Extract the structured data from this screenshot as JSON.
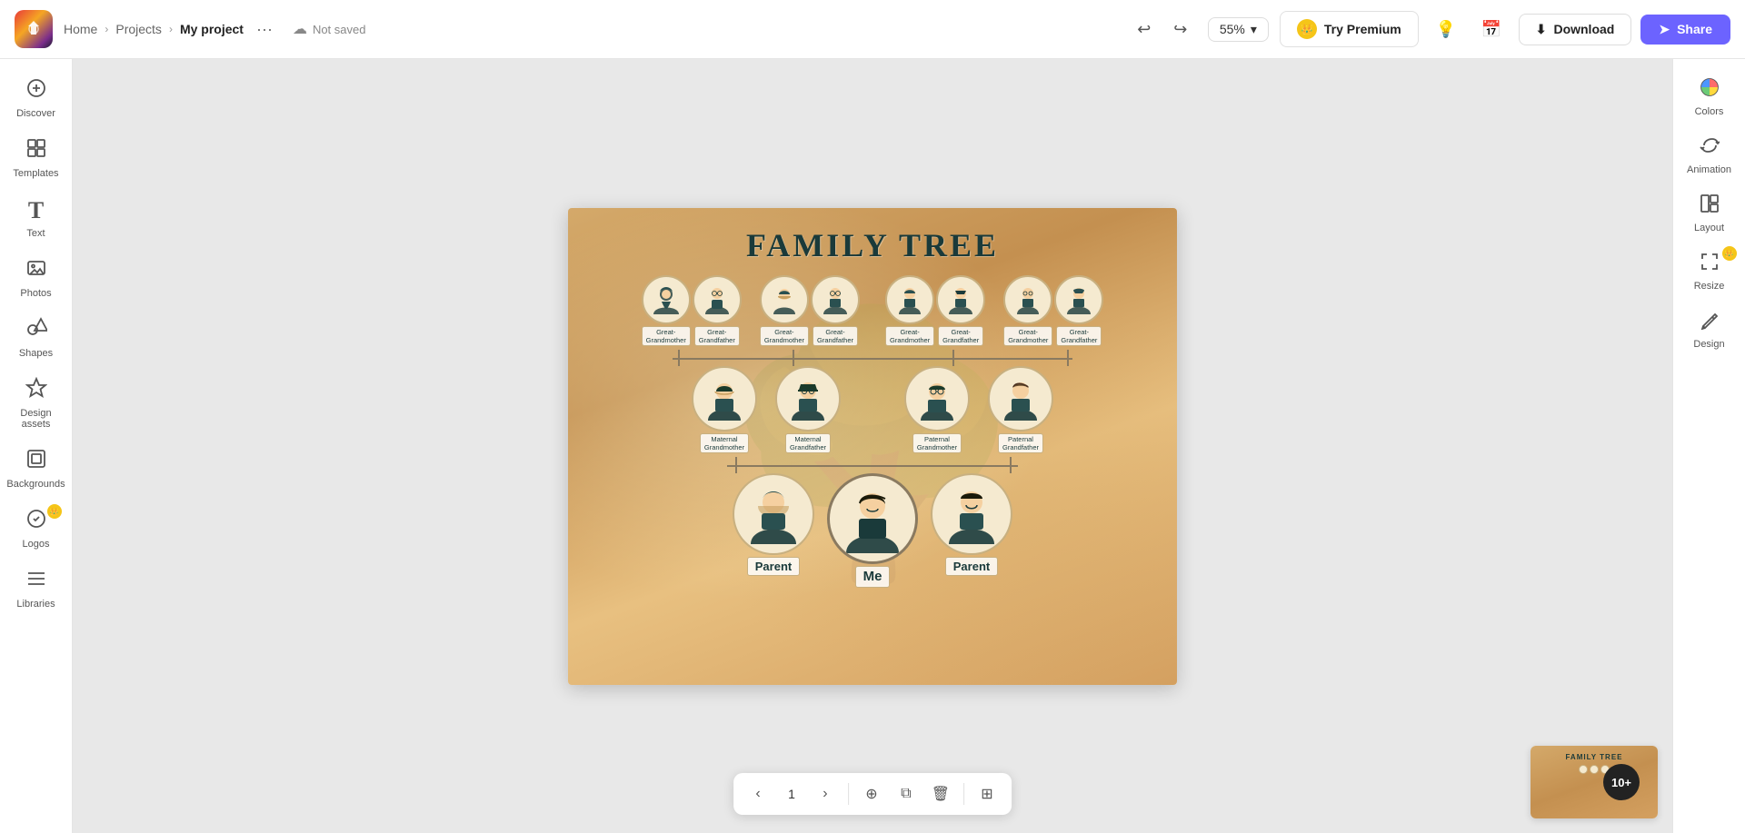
{
  "app": {
    "logo_text": "A",
    "breadcrumb": {
      "home": "Home",
      "projects": "Projects",
      "current": "My project"
    },
    "save_status": "Not saved",
    "zoom": "55%",
    "buttons": {
      "try_premium": "Try Premium",
      "download": "Download",
      "share": "Share"
    }
  },
  "sidebar_left": {
    "items": [
      {
        "id": "discover",
        "icon": "⊞",
        "label": "Discover"
      },
      {
        "id": "templates",
        "icon": "⊡",
        "label": "Templates"
      },
      {
        "id": "text",
        "icon": "T",
        "label": "Text"
      },
      {
        "id": "photos",
        "icon": "🖼",
        "label": "Photos"
      },
      {
        "id": "shapes",
        "icon": "◯",
        "label": "Shapes"
      },
      {
        "id": "design-assets",
        "icon": "✦",
        "label": "Design assets"
      },
      {
        "id": "backgrounds",
        "icon": "▣",
        "label": "Backgrounds"
      },
      {
        "id": "logos",
        "icon": "◈",
        "label": "Logos",
        "badge": "crown"
      },
      {
        "id": "libraries",
        "icon": "⊟",
        "label": "Libraries"
      }
    ]
  },
  "sidebar_right": {
    "items": [
      {
        "id": "colors",
        "icon": "◑",
        "label": "Colors"
      },
      {
        "id": "animation",
        "icon": "◈",
        "label": "Animation"
      },
      {
        "id": "layout",
        "icon": "⊞",
        "label": "Layout"
      },
      {
        "id": "resize",
        "icon": "⤡",
        "label": "Resize",
        "badge": "crown"
      },
      {
        "id": "design",
        "icon": "✏",
        "label": "Design"
      }
    ]
  },
  "canvas": {
    "title": "FAMILY TREE",
    "generation1": [
      {
        "label": "Great-\nGrandmother"
      },
      {
        "label": "Great-\nGrandfather"
      },
      {
        "label": "Great-\nGrandmother"
      },
      {
        "label": "Great-\nGrandfather"
      },
      {
        "label": "Great-\nGrandmother"
      },
      {
        "label": "Great-\nGrandfather"
      },
      {
        "label": "Great-\nGrandmother"
      },
      {
        "label": "Great-\nGrandfather"
      }
    ],
    "generation2": [
      {
        "label": "Maternal\nGrandmother"
      },
      {
        "label": "Maternal\nGrandfather"
      },
      {
        "label": "Paternal\nGrandmother"
      },
      {
        "label": "Paternal\nGrandfather"
      }
    ],
    "generation3": [
      {
        "label": "Parent"
      },
      {
        "label": "Me"
      },
      {
        "label": "Parent"
      }
    ]
  },
  "page_toolbar": {
    "page_number": "1",
    "add_page_tooltip": "Add page",
    "duplicate_tooltip": "Duplicate",
    "delete_tooltip": "Delete",
    "grid_tooltip": "Grid view"
  },
  "thumbnail": {
    "count": "10+"
  }
}
